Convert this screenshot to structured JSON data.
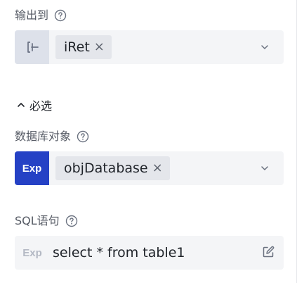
{
  "output": {
    "label": "输出到",
    "tag": "iRet",
    "prefix_icon": "variable-bracket-icon"
  },
  "section": {
    "toggle_glyph": "^",
    "title": "必选"
  },
  "database": {
    "label": "数据库对象",
    "prefix": "Exp",
    "tag": "objDatabase"
  },
  "sql": {
    "label": "SQL语句",
    "prefix": "Exp",
    "value": "select * from table1"
  },
  "close_glyph": "×",
  "colors": {
    "exp_active_bg": "#2541c5",
    "exp_inactive_text": "#b4b9c4",
    "field_bg": "#f4f5f7",
    "tag_bg": "#e4e6eb"
  }
}
